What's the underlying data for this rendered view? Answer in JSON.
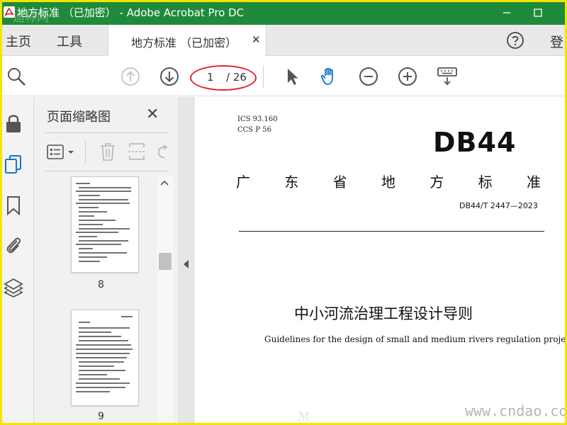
{
  "window": {
    "title": "地方标准 （已加密） - Adobe Acrobat Pro DC",
    "watermark_top_left": "迪称网"
  },
  "menu": {
    "home": "主页",
    "tools": "工具",
    "doc_tab": "地方标准 （已加密）",
    "login": "登"
  },
  "toolbar": {
    "current_page": "1",
    "total_pages": "/ 26"
  },
  "panel": {
    "title": "页面缩略图",
    "thumbnails": [
      {
        "page": "8"
      },
      {
        "page": "9"
      }
    ]
  },
  "document": {
    "ics": "ICS 93.160",
    "ccs": "CCS P 56",
    "code": "DB44",
    "chars": [
      "广",
      "东",
      "省",
      "地",
      "方",
      "标",
      "准"
    ],
    "standard_number": "DB44/T 2447—2023",
    "title_cn": "中小河流治理工程设计导则",
    "title_en": "Guidelines for the design of small and medium rivers regulation project"
  },
  "watermark": {
    "site": "www.cndao.com"
  },
  "colors": {
    "title_bar": "#1f8a3a",
    "annotation_ellipse": "#e4242b",
    "accent_blue": "#1a73c9"
  }
}
